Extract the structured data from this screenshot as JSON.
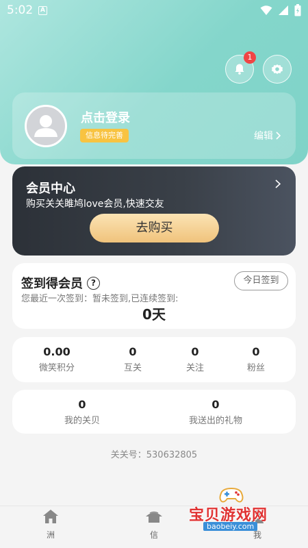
{
  "status_bar": {
    "time": "5:02",
    "a_icon": "A",
    "icons": [
      "wifi-icon",
      "signal-icon",
      "battery-icon"
    ]
  },
  "header": {
    "notification_count": "1",
    "icons": [
      "bell-icon",
      "gear-icon"
    ]
  },
  "profile": {
    "login_text": "点击登录",
    "info_tag": "信息待完善",
    "edit_label": "编辑"
  },
  "vip": {
    "title": "会员中心",
    "subtitle": "购买关关雎鸠love会员,快速交友",
    "buy_label": "去购买"
  },
  "signin": {
    "title": "签到得会员",
    "today_button": "今日签到",
    "description": "您最近一次签到：暂未签到,已连续签到:",
    "days": "0天"
  },
  "stats": [
    {
      "value": "0.00",
      "label": "微笑积分"
    },
    {
      "value": "0",
      "label": "互关"
    },
    {
      "value": "0",
      "label": "关注"
    },
    {
      "value": "0",
      "label": "粉丝"
    }
  ],
  "gifts": [
    {
      "value": "0",
      "label": "我的关贝"
    },
    {
      "value": "0",
      "label": "我送出的礼物"
    }
  ],
  "account": {
    "text": "关关号：530632805"
  },
  "tabs": [
    {
      "label": "洲",
      "icon": "home-icon"
    },
    {
      "label": "信",
      "icon": "message-icon"
    },
    {
      "label": "我",
      "icon": "profile-icon"
    }
  ],
  "watermark": {
    "text": "宝贝游戏网",
    "url": "baobeiy.com"
  },
  "colors": {
    "teal": "#84d6cb",
    "gold": "#f0c37c",
    "dark": "#2c3138",
    "badge": "#f04545",
    "tag": "#f8c341"
  }
}
